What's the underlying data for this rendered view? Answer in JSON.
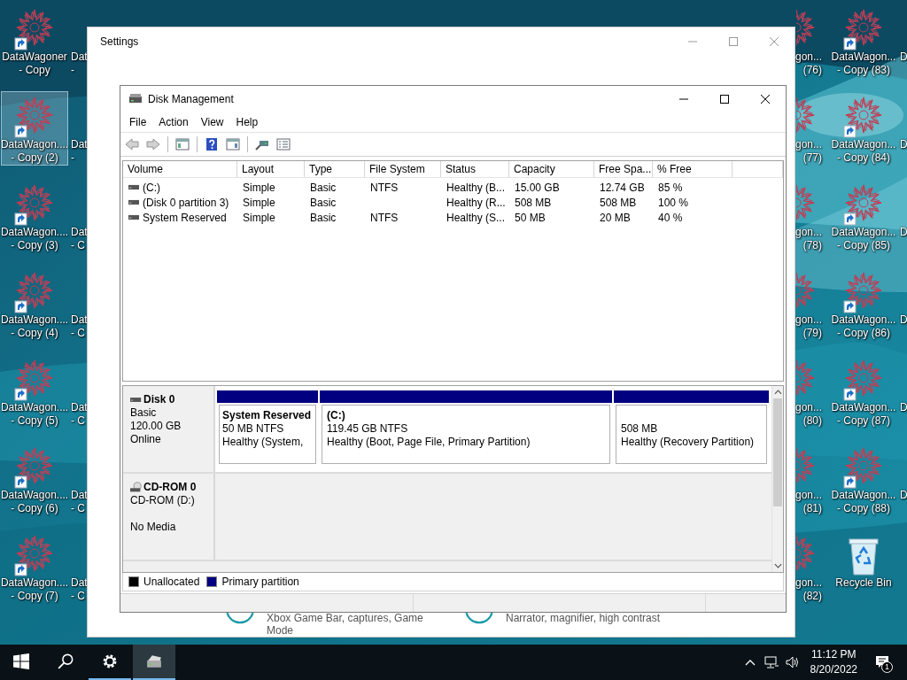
{
  "desktop": {
    "left_columns": [
      {
        "icons": [
          {
            "label": "DataWagoner\n- Copy",
            "kind": "shortcut",
            "selected": false
          },
          {
            "label": "DataWagon....\n- Copy (2)",
            "kind": "shortcut",
            "selected": true
          },
          {
            "label": "DataWagon....\n- Copy (3)",
            "kind": "shortcut",
            "selected": false
          },
          {
            "label": "DataWagon....\n- Copy (4)",
            "kind": "shortcut",
            "selected": false
          },
          {
            "label": "DataWagon....\n- Copy (5)",
            "kind": "shortcut",
            "selected": false
          },
          {
            "label": "DataWagon....\n- Copy (6)",
            "kind": "shortcut",
            "selected": false
          },
          {
            "label": "DataWagon....\n- Copy (7)",
            "kind": "shortcut",
            "selected": false
          }
        ]
      },
      {
        "icons": [
          {
            "label": "Dat\n-",
            "kind": "clipped_label",
            "selected": false
          },
          {
            "label": "Dat\n-",
            "kind": "clipped_label",
            "selected": false
          },
          {
            "label": "Dat\n- C",
            "kind": "clipped_label",
            "selected": false
          },
          {
            "label": "Dat\n- C",
            "kind": "clipped_label",
            "selected": false
          },
          {
            "label": "Dat\n- C",
            "kind": "clipped_label",
            "selected": false
          },
          {
            "label": "Dat\n- C",
            "kind": "clipped_label",
            "selected": false
          },
          {
            "label": "Dat\n- C",
            "kind": "clipped_label",
            "selected": false
          }
        ]
      }
    ],
    "right_columns": [
      {
        "icons": [
          {
            "label": "gon...\n(76)",
            "kind": "clipped_shortcut",
            "selected": false
          },
          {
            "label": "gon...\n(77)",
            "kind": "clipped_shortcut",
            "selected": false
          },
          {
            "label": "gon...\n(78)",
            "kind": "clipped_shortcut",
            "selected": false
          },
          {
            "label": "gon...\n(79)",
            "kind": "clipped_shortcut",
            "selected": false
          },
          {
            "label": "gon...\n(80)",
            "kind": "clipped_shortcut",
            "selected": false
          },
          {
            "label": "gon...\n(81)",
            "kind": "clipped_shortcut",
            "selected": false
          },
          {
            "label": "gon...\n(82)",
            "kind": "clipped_shortcut",
            "selected": false
          }
        ]
      },
      {
        "icons": [
          {
            "label": "DataWagon...\n- Copy (83)",
            "kind": "shortcut",
            "selected": false
          },
          {
            "label": "DataWagon...\n- Copy (84)",
            "kind": "shortcut",
            "selected": false
          },
          {
            "label": "DataWagon...\n- Copy (85)",
            "kind": "shortcut",
            "selected": false
          },
          {
            "label": "DataWagon...\n- Copy (86)",
            "kind": "shortcut",
            "selected": false
          },
          {
            "label": "DataWagon...\n- Copy (87)",
            "kind": "shortcut",
            "selected": false
          },
          {
            "label": "DataWagon...\n- Copy (88)",
            "kind": "shortcut",
            "selected": false
          },
          {
            "label": "Recycle Bin",
            "kind": "recycle_bin",
            "selected": false
          }
        ]
      },
      {
        "icons": [
          {
            "label": "D",
            "kind": "clipped_label",
            "selected": false
          },
          {
            "label": "D",
            "kind": "clipped_label",
            "selected": false
          },
          {
            "label": "D",
            "kind": "clipped_label",
            "selected": false
          },
          {
            "label": "D",
            "kind": "clipped_label",
            "selected": false
          },
          {
            "label": "D",
            "kind": "clipped_label",
            "selected": false
          },
          {
            "label": "D",
            "kind": "clipped_label",
            "selected": false
          }
        ]
      }
    ]
  },
  "settings_window": {
    "title": "Settings",
    "items": [
      {
        "description": "Xbox Game Bar, captures, Game Mode"
      },
      {
        "description": "Narrator, magnifier, high contrast"
      }
    ]
  },
  "disk_management": {
    "title": "Disk Management",
    "menu": [
      "File",
      "Action",
      "View",
      "Help"
    ],
    "toolbar": [
      {
        "kind": "back",
        "disabled": true
      },
      {
        "kind": "forward",
        "disabled": true
      },
      {
        "kind": "separator"
      },
      {
        "kind": "console_tree",
        "disabled": false
      },
      {
        "kind": "separator"
      },
      {
        "kind": "help",
        "disabled": false
      },
      {
        "kind": "action_pane",
        "disabled": false
      },
      {
        "kind": "separator"
      },
      {
        "kind": "connect",
        "disabled": false
      },
      {
        "kind": "properties",
        "disabled": false
      }
    ],
    "volume_list": {
      "columns": [
        "Volume",
        "Layout",
        "Type",
        "File System",
        "Status",
        "Capacity",
        "Free Spa...",
        "% Free"
      ],
      "rows": [
        {
          "cells": [
            "(C:)",
            "Simple",
            "Basic",
            "NTFS",
            "Healthy (B...",
            "15.00 GB",
            "12.74 GB",
            "85 %"
          ]
        },
        {
          "cells": [
            "(Disk 0 partition 3)",
            "Simple",
            "Basic",
            null,
            "Healthy (R...",
            "508 MB",
            "508 MB",
            "100 %"
          ]
        },
        {
          "cells": [
            "System Reserved",
            "Simple",
            "Basic",
            "NTFS",
            "Healthy (S...",
            "50 MB",
            "20 MB",
            "40 %"
          ]
        }
      ]
    },
    "disks": [
      {
        "kind": "disk",
        "name": "Disk 0",
        "type_line": "Basic",
        "size": "120.00 GB",
        "status": "Online",
        "partitions": [
          {
            "kind": "primary",
            "name": "System Reserved",
            "size": "50 MB NTFS",
            "status": "Healthy (System,"
          },
          {
            "kind": "primary",
            "name": "(C:)",
            "size": "119.45 GB NTFS",
            "status": "Healthy (Boot, Page File, Primary Partition)"
          },
          {
            "kind": "primary",
            "size": "508 MB",
            "status": "Healthy (Recovery Partition)"
          }
        ]
      },
      {
        "kind": "cdrom",
        "name": "CD-ROM 0",
        "type_line": "CD-ROM (D:)",
        "status": "No Media"
      }
    ],
    "legend": [
      {
        "kind": "unallocated",
        "label": "Unallocated",
        "color": "#000000"
      },
      {
        "kind": "primary",
        "label": "Primary partition",
        "color": "#000080"
      }
    ]
  },
  "taskbar": {
    "buttons": [
      {
        "kind": "start",
        "open": false,
        "selected": false
      },
      {
        "kind": "search",
        "open": false,
        "selected": false
      },
      {
        "kind": "settings",
        "open": true,
        "selected": false
      },
      {
        "kind": "disk_management",
        "open": true,
        "selected": true
      }
    ],
    "tray": {
      "time": "11:12 PM",
      "date": "8/20/2022",
      "notification_count": "1"
    }
  }
}
